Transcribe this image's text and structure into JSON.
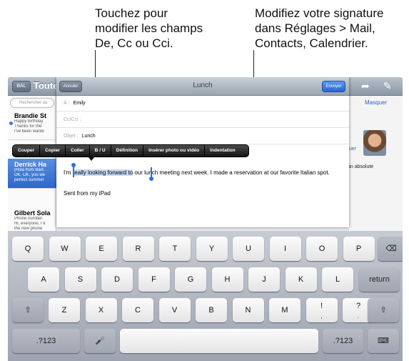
{
  "callouts": {
    "left": [
      "Touchez pour",
      "modifier les champs",
      "De, Cc ou Cci."
    ],
    "right": [
      "Modifiez votre signature",
      "dans Réglages > Mail,",
      "Contacts, Calendrier."
    ]
  },
  "mail_background": {
    "mailbox_button": "BAL",
    "title": "Toute",
    "search_placeholder": "Rechercher da",
    "hide_link": "Masquer",
    "right_link_fragment": "uer",
    "right_text_fragment": "an absolute",
    "messages": [
      {
        "sender": "Brandie St",
        "lines": [
          "Happy birthday",
          "Thanks for the",
          "I've been wante"
        ],
        "unread": true,
        "selected": false
      },
      {
        "sender": "Derrick Ha",
        "lines": [
          "[Hola from Barc",
          "OK, OK, you we",
          "perfect summer"
        ],
        "unread": false,
        "selected": true
      },
      {
        "sender": "Gilbert Sola",
        "lines": [
          "Phone number",
          "Hi, everyone. I ti",
          "the new phone"
        ],
        "unread": false,
        "selected": false
      }
    ]
  },
  "compose": {
    "cancel_label": "Annuler",
    "title": "Lunch",
    "send_label": "Envoyer",
    "to_label": "À :",
    "to_value": "Emily",
    "cc_label": "Cc/Cci :",
    "subject_label": "Objet :",
    "subject_value": "Lunch",
    "body_before": "I'm ",
    "body_selected": "really looking forward to",
    "body_after": " our lunch meeting next week. I made a reservation at our favorite Italian spot.",
    "signature": "Sent from my iPad"
  },
  "edit_menu": [
    "Couper",
    "Copier",
    "Coller",
    "B / U",
    "Définition",
    "Insérer photo ou vidéo",
    "Indentation"
  ],
  "keyboard": {
    "row1": [
      "Q",
      "W",
      "E",
      "R",
      "T",
      "Y",
      "U",
      "I",
      "O",
      "P"
    ],
    "row2": [
      "A",
      "S",
      "D",
      "F",
      "G",
      "H",
      "J",
      "K",
      "L"
    ],
    "row3": [
      "Z",
      "X",
      "C",
      "V",
      "B",
      "N",
      "M",
      "!",
      "?"
    ],
    "row3_sub": [
      ",",
      "."
    ],
    "return_label": "return",
    "numbers_label": ".?123",
    "backspace_icon": "backspace-icon",
    "shift_icon": "shift-icon",
    "mic_icon": "microphone-icon",
    "hide_keyboard_icon": "keyboard-dismiss-icon"
  }
}
